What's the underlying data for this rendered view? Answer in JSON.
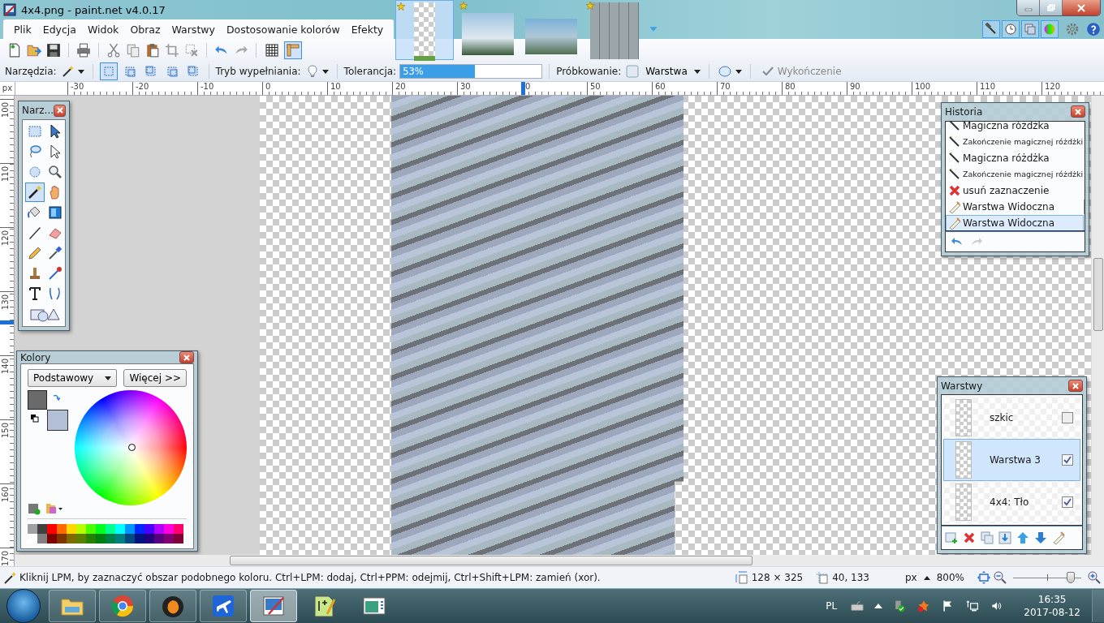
{
  "window": {
    "title": "4x4.png - paint.net v4.0.17"
  },
  "image_tabs": [
    {
      "kind": "transparent",
      "selected": true,
      "modified": true
    },
    {
      "kind": "tower-photo",
      "selected": false,
      "modified": true
    },
    {
      "kind": "city-photo",
      "selected": false,
      "modified": false
    },
    {
      "kind": "grid-image",
      "selected": false,
      "modified": true
    }
  ],
  "panel_toggles": [
    {
      "kind": "tools",
      "selected": true
    },
    {
      "kind": "history",
      "selected": true
    },
    {
      "kind": "layers",
      "selected": true
    },
    {
      "kind": "colors",
      "selected": true
    }
  ],
  "menu": [
    "Plik",
    "Edycja",
    "Widok",
    "Obraz",
    "Warstwy",
    "Dostosowanie kolorów",
    "Efekty"
  ],
  "toolbar_toggles": [
    {
      "kind": "grid",
      "selected": false
    },
    {
      "kind": "ruler",
      "selected": true
    }
  ],
  "tool_options": {
    "tools_label": "Narzędzia:",
    "selection_modes": [
      {
        "selected": true
      },
      {
        "selected": false
      },
      {
        "selected": false
      },
      {
        "selected": false
      },
      {
        "selected": false
      }
    ],
    "fill_mode_label": "Tryb wypełniania:",
    "tolerance_label": "Tolerancja:",
    "tolerance": {
      "reading": "53%",
      "level": 0.53
    },
    "sampling_label": "Próbkowanie:",
    "sampling_value": "Warstwa",
    "finish": {
      "label": "Wykończenie",
      "disabled": true
    }
  },
  "ruler": {
    "unit": "px",
    "horizontal": [
      "-30",
      "-20",
      "-10",
      "0",
      "10",
      "20",
      "30",
      "0",
      "50",
      "60",
      "70",
      "80",
      "90",
      "100",
      "110",
      "120"
    ],
    "vertical": [
      "100",
      "110",
      "120",
      "130",
      "140",
      "150",
      "160",
      "170"
    ]
  },
  "tools_window": {
    "title": "Narz...",
    "tools": [
      {
        "kind": "rectangle-select",
        "selected": false
      },
      {
        "kind": "move-arrow",
        "selected": false
      },
      {
        "kind": "lasso",
        "selected": false
      },
      {
        "kind": "move-selection",
        "selected": false
      },
      {
        "kind": "ellipse-select",
        "selected": false
      },
      {
        "kind": "zoom",
        "selected": false
      },
      {
        "kind": "magic-wand",
        "selected": true
      },
      {
        "kind": "hand",
        "selected": false
      },
      {
        "kind": "paint-bucket",
        "selected": false
      },
      {
        "kind": "gradient",
        "selected": false
      },
      {
        "kind": "paintbrush",
        "selected": false
      },
      {
        "kind": "eraser",
        "selected": false
      },
      {
        "kind": "pencil",
        "selected": false
      },
      {
        "kind": "color-picker",
        "selected": false
      },
      {
        "kind": "clone-stamp",
        "selected": false
      },
      {
        "kind": "recolor",
        "selected": false
      },
      {
        "kind": "text",
        "selected": false
      },
      {
        "kind": "line-curve",
        "selected": false
      },
      {
        "kind": "shapes",
        "selected": false
      }
    ]
  },
  "colors_window": {
    "title": "Kolory",
    "palette_select": "Podstawowy",
    "more_button": "Więcej >>",
    "primary": {
      "color": "#6a6a6a"
    },
    "secondary": {
      "color": "#b3bfd6"
    },
    "palette": [
      {
        "color": "#a0a0a0"
      },
      {
        "color": "#404040"
      },
      {
        "color": "#ff0000"
      },
      {
        "color": "#ff6a00"
      },
      {
        "color": "#ffd800"
      },
      {
        "color": "#b6ff00"
      },
      {
        "color": "#4cff00"
      },
      {
        "color": "#00ff21"
      },
      {
        "color": "#00ff90"
      },
      {
        "color": "#00ffff"
      },
      {
        "color": "#0094ff"
      },
      {
        "color": "#0026ff"
      },
      {
        "color": "#4800ff"
      },
      {
        "color": "#b200ff"
      },
      {
        "color": "#ff00dc"
      },
      {
        "color": "#ff006e"
      },
      {
        "color": "#ffffff"
      },
      {
        "color": "#808080"
      },
      {
        "color": "#7f0000"
      },
      {
        "color": "#7f3300"
      },
      {
        "color": "#7f6a00"
      },
      {
        "color": "#5b7f00"
      },
      {
        "color": "#267f00"
      },
      {
        "color": "#007f0e"
      },
      {
        "color": "#007f46"
      },
      {
        "color": "#007f7f"
      },
      {
        "color": "#004a7f"
      },
      {
        "color": "#00137f"
      },
      {
        "color": "#21007f"
      },
      {
        "color": "#57007f"
      },
      {
        "color": "#7f006e"
      },
      {
        "color": "#7f0037"
      }
    ]
  },
  "history_window": {
    "title": "Historia",
    "items": [
      {
        "kind": "wand",
        "label": "Magiczna różdżka",
        "selected": false
      },
      {
        "kind": "wand-finish",
        "label": "Zakończenie magicznej różdżki",
        "selected": false
      },
      {
        "kind": "wand",
        "label": "Magiczna różdżka",
        "selected": false
      },
      {
        "kind": "wand-finish",
        "label": "Zakończenie magicznej różdżki",
        "selected": false
      },
      {
        "kind": "delete",
        "label": "usuń zaznaczenie",
        "selected": false
      },
      {
        "kind": "layer-properties",
        "label": "Warstwa Widoczna",
        "selected": false
      },
      {
        "kind": "layer-properties",
        "label": "Warstwa Widoczna",
        "selected": true
      }
    ]
  },
  "layers_window": {
    "title": "Warstwy",
    "layers": [
      {
        "name": "szkic",
        "visible": false,
        "selected": false
      },
      {
        "name": "Warstwa 3",
        "visible": true,
        "selected": true
      },
      {
        "name": "4x4: Tło",
        "visible": true,
        "selected": false
      }
    ]
  },
  "status_bar": {
    "hint": "Kliknij LPM, by zaznaczyć obszar podobnego koloru. Ctrl+LPM: dodaj, Ctrl+PPM: odejmij, Ctrl+Shift+LPM: zamień (xor).",
    "size": "128 × 325",
    "position": "40, 133",
    "unit": "px",
    "zoom": "800%",
    "zoom_slider": {
      "level": 0.84
    }
  },
  "taskbar": {
    "apps": [
      {
        "kind": "folder",
        "selected": false
      },
      {
        "kind": "browser",
        "selected": false
      },
      {
        "kind": "fruit",
        "selected": false
      },
      {
        "kind": "plane",
        "selected": false
      },
      {
        "kind": "paint",
        "selected": true
      },
      {
        "kind": "notepad",
        "selected": false
      },
      {
        "kind": "window",
        "selected": false
      }
    ],
    "language": "PL",
    "time": "16:35",
    "date": "2017-08-12"
  }
}
